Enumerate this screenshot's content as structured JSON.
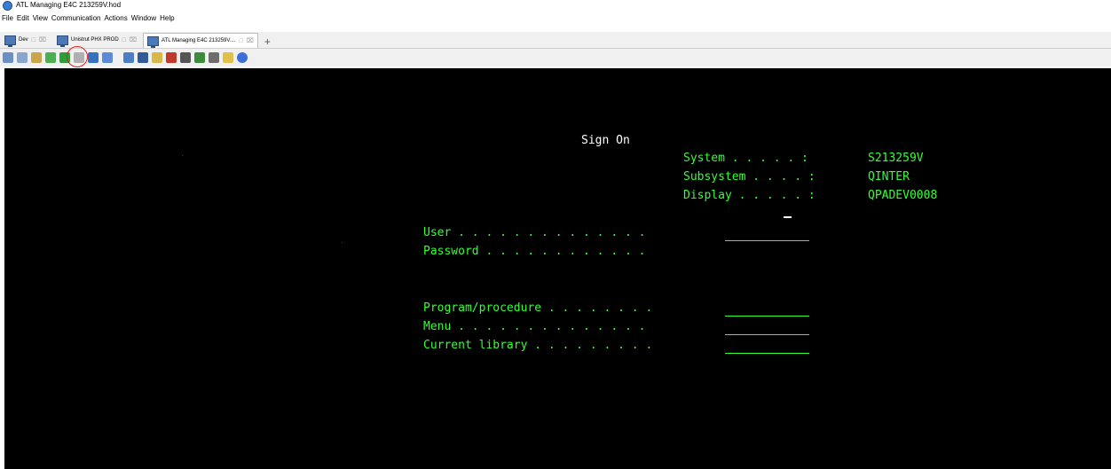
{
  "window": {
    "title": "ATL Managing E4C 213259V.hod"
  },
  "menu": [
    "File",
    "Edit",
    "View",
    "Communication",
    "Actions",
    "Window",
    "Help"
  ],
  "tabs": [
    {
      "label": "Dev",
      "active": false
    },
    {
      "label": "Unistrut PHX PROD",
      "active": false
    },
    {
      "label": "ATL Managing E4C 213259V....",
      "active": true
    }
  ],
  "tab_controls": {
    "restore": "□",
    "close": "⌧",
    "add": "+"
  },
  "toolbar_icons": [
    "copy-icon",
    "paste-icon",
    "print-icon",
    "send-file-icon",
    "receive-file-icon",
    "file-transfer-icon",
    "macro-icon",
    "record-icon",
    "keypad-icon",
    "display-icon",
    "settings-icon",
    "upload-icon",
    "stack-icon",
    "download-icon",
    "chart-icon",
    "document-icon",
    "help-icon"
  ],
  "terminal": {
    "heading": "Sign On",
    "system_label": "System . . . . . :",
    "system_value": "S213259V",
    "subsystem_label": "Subsystem . . . . :",
    "subsystem_value": "QINTER",
    "display_label": "Display . . . . . :",
    "display_value": "QPADEV0008",
    "user_label": "User . . . . . . . . . . . . . .",
    "password_label": "Password . . . . . . . . . . . .",
    "program_label": "Program/procedure . . . . . . . .",
    "menu_label": "Menu . . . . . . . . . . . . . .",
    "library_label": "Current library . . . . . . . . ."
  },
  "colors": {
    "terminal_bg": "#000000",
    "terminal_fg": "#33ff33",
    "highlight": "#e02020"
  }
}
